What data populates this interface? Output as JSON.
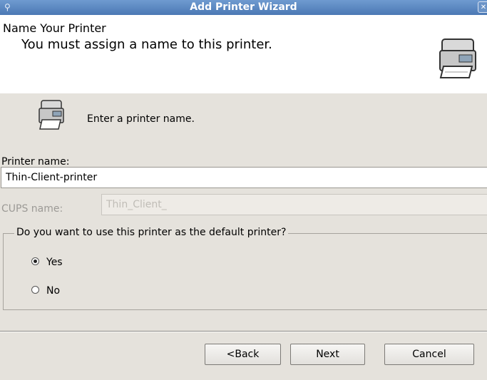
{
  "window": {
    "title": "Add Printer Wizard"
  },
  "header": {
    "title": "Name Your Printer",
    "subtitle": "You must assign a name to this printer."
  },
  "intro_text": "Enter a printer name.",
  "printer_name": {
    "label": "Printer name:",
    "value": "Thin-Client-printer"
  },
  "cups_name": {
    "label": "CUPS name:",
    "value": "Thin_Client_"
  },
  "default_group": {
    "legend": "Do you want to use this printer as the default printer?",
    "options": [
      {
        "label": "Yes",
        "selected": true
      },
      {
        "label": "No",
        "selected": false
      }
    ]
  },
  "buttons": {
    "back": "<Back",
    "next": "Next",
    "cancel": "Cancel"
  }
}
